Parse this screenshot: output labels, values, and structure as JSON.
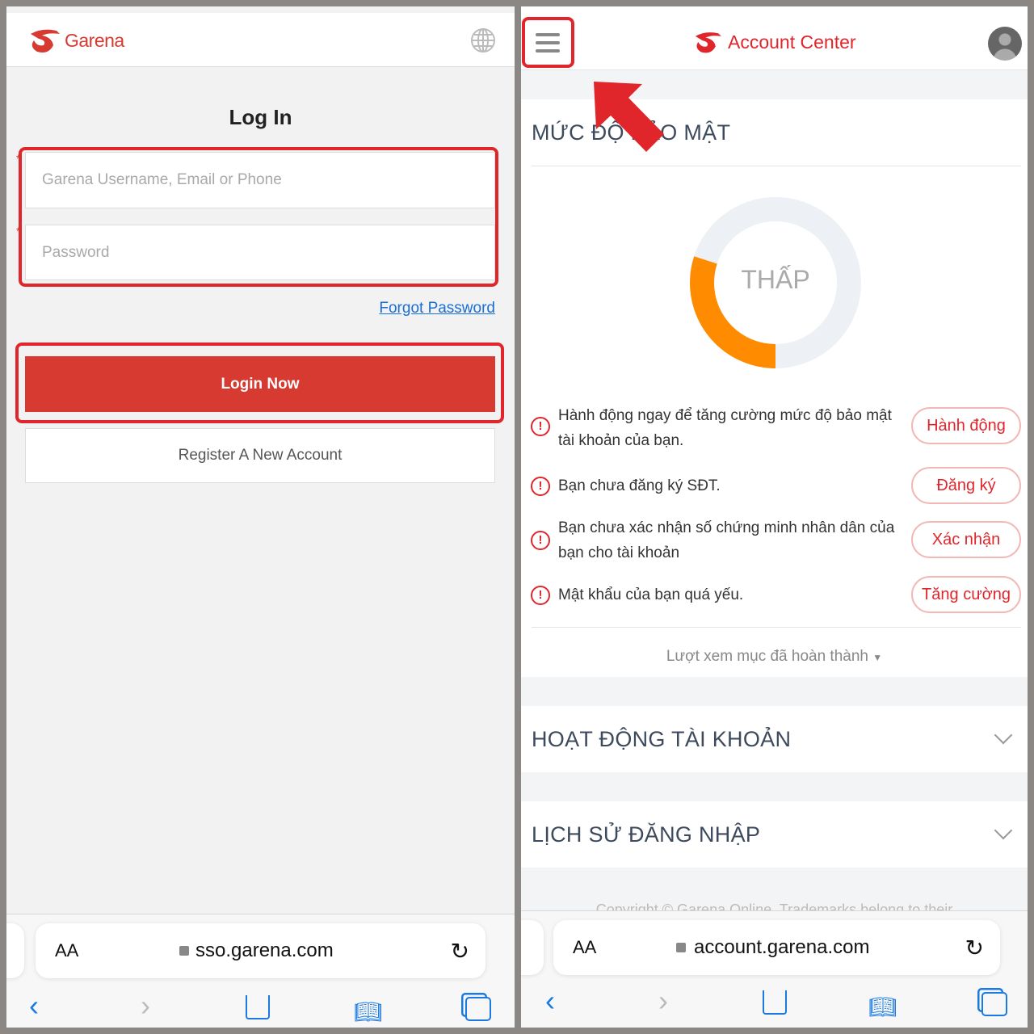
{
  "colors": {
    "brand": "#d63a30",
    "highlight": "#e0262b",
    "link": "#1a6fd6",
    "orange": "#ff8c00",
    "ios_blue": "#1a7ae0"
  },
  "left": {
    "logo_text": "Garena",
    "title": "Log In",
    "username_placeholder": "Garena Username, Email or Phone",
    "password_placeholder": "Password",
    "forgot_password": "Forgot Password",
    "login_button": "Login Now",
    "register_button": "Register A New Account",
    "browser": {
      "text_size": "AA",
      "url": "sso.garena.com"
    }
  },
  "right": {
    "title": "Account Center",
    "security": {
      "heading": "MỨC ĐỘ BẢO MẬT",
      "level_label": "THẤP",
      "level_percent": 30,
      "items": [
        {
          "text": "Hành động ngay để tăng cường mức độ bảo mật tài khoản của bạn.",
          "button": "Hành động"
        },
        {
          "text": "Bạn chưa đăng ký SĐT.",
          "button": "Đăng ký"
        },
        {
          "text": "Bạn chưa xác nhận số chứng minh nhân dân của bạn cho tài khoản",
          "button": "Xác nhận"
        },
        {
          "text": "Mật khẩu của bạn quá yếu.",
          "button": "Tăng cường"
        }
      ],
      "view_completed": "Lượt xem mục đã hoàn thành"
    },
    "activity_heading": "HOẠT ĐỘNG TÀI KHOẢN",
    "login_history_heading": "LỊCH SỬ ĐĂNG NHẬP",
    "copyright": "Copyright © Garena Online. Trademarks belong to their",
    "browser": {
      "text_size": "AA",
      "url": "account.garena.com"
    }
  }
}
